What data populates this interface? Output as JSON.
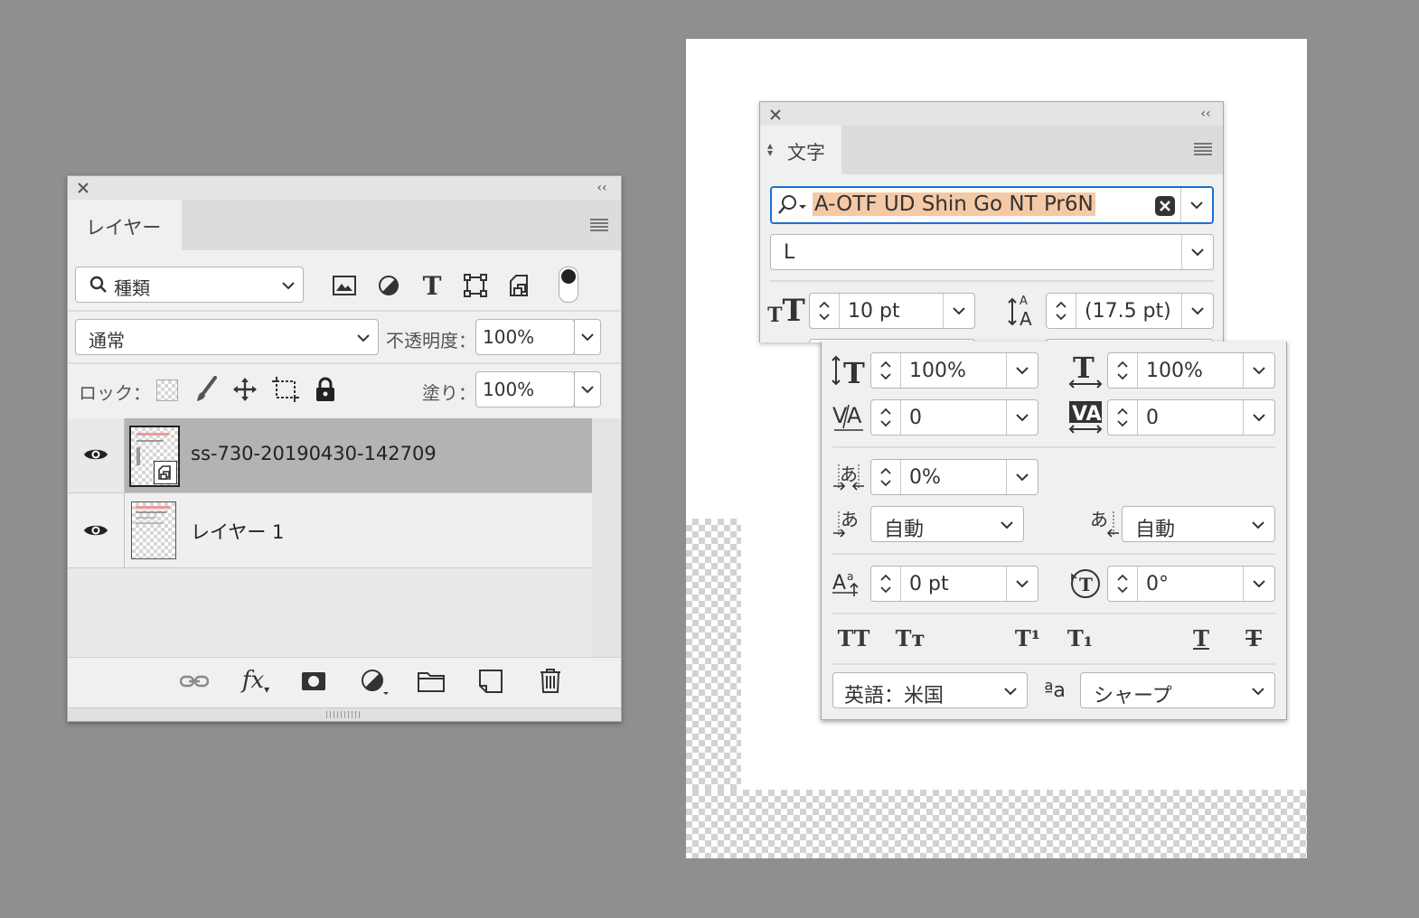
{
  "layers_panel": {
    "tab_label": "レイヤー",
    "filter": {
      "label": "種類"
    },
    "filter_icons": [
      "image-icon",
      "adjustment-icon",
      "type-icon",
      "shape-icon",
      "smart-object-icon"
    ],
    "blend_mode": "通常",
    "opacity_label": "不透明度：",
    "opacity_value": "100%",
    "lock_label": "ロック：",
    "fill_label": "塗り：",
    "fill_value": "100%",
    "layers": [
      {
        "name": "ss-730-20190430-142709",
        "visible": true,
        "selected": true
      },
      {
        "name": "レイヤー 1",
        "visible": true,
        "selected": false
      }
    ],
    "footer_icons": [
      "link-icon",
      "fx-icon",
      "mask-icon",
      "adjustment-icon",
      "folder-icon",
      "new-layer-icon",
      "trash-icon"
    ]
  },
  "character_panel": {
    "tab_label": "文字",
    "font_family": "A-OTF UD Shin Go NT Pr6N",
    "font_style": "L",
    "font_size": "10 pt",
    "leading": "(17.5 pt)",
    "vertical_scale": "100%",
    "horizontal_scale": "100%",
    "kerning": "0",
    "tracking": "0",
    "tsume": "0%",
    "aki_left": "自動",
    "aki_right": "自動",
    "baseline_shift": "0 pt",
    "rotation": "0°",
    "style_buttons": [
      "TT",
      "Tт",
      "T¹",
      "T₁",
      "T",
      "T"
    ],
    "language": "英語：米国",
    "antialias_icon_label": "ªa",
    "antialias": "シャープ",
    "accent_color": "#1a6fd6",
    "selection_color": "#f5c9a5"
  }
}
